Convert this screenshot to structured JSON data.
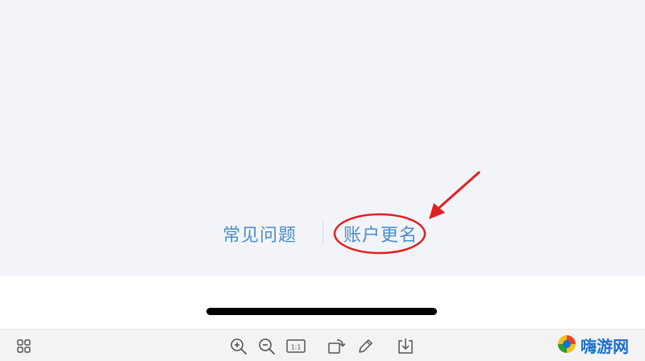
{
  "links": {
    "faq_label": "常见问题",
    "rename_label": "账户更名"
  },
  "annotation": {
    "color": "#e02020",
    "shape": "ellipse-with-arrow"
  },
  "toolbar": {
    "icons": [
      "grid-icon",
      "zoom-in-icon",
      "zoom-out-icon",
      "actual-size-icon",
      "rotate-icon",
      "edit-icon",
      "download-icon"
    ],
    "actual_size_label": "1:1"
  },
  "watermark": {
    "text": "嗨游网"
  },
  "colors": {
    "page_background": "#f3f4f9",
    "link": "#4a8ec8",
    "toolbar": "#f3f3f3"
  }
}
